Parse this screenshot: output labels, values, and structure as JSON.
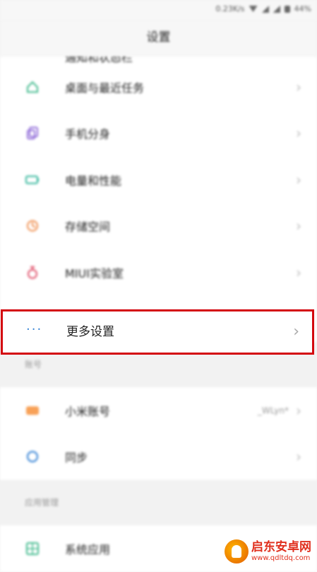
{
  "status": {
    "speed": "0.23K/s",
    "battery": "44%"
  },
  "header": {
    "title": "设置"
  },
  "top_list": [
    {
      "label": "通知和状态栏",
      "icon": "notification-icon",
      "color": "#5b8fe3"
    },
    {
      "label": "桌面与最近任务",
      "icon": "home-icon",
      "color": "#3cb88a"
    },
    {
      "label": "手机分身",
      "icon": "clone-icon",
      "color": "#8f6ad8"
    },
    {
      "label": "电量和性能",
      "icon": "battery-icon",
      "color": "#2fb59a"
    },
    {
      "label": "存储空间",
      "icon": "storage-icon",
      "color": "#f08c4a"
    },
    {
      "label": "MIUI实验室",
      "icon": "lab-icon",
      "color": "#e0506a"
    }
  ],
  "highlight": {
    "label": "更多设置",
    "icon": "more-icon",
    "color": "#3a86d6",
    "border": "#d4070f"
  },
  "account_section": {
    "title": "账号",
    "items": [
      {
        "label": "小米账号",
        "value": "_WLyn*",
        "icon": "mi-account-icon",
        "color": "#f7913a"
      },
      {
        "label": "同步",
        "value": "",
        "icon": "sync-icon",
        "color": "#3a86d6"
      }
    ]
  },
  "app_section": {
    "title": "应用管理",
    "items": [
      {
        "label": "系统应用",
        "icon": "apps-icon",
        "color": "#3cb88a"
      }
    ]
  },
  "watermark": {
    "main": "启东安卓网",
    "sub": "www.qdltdq.com"
  }
}
